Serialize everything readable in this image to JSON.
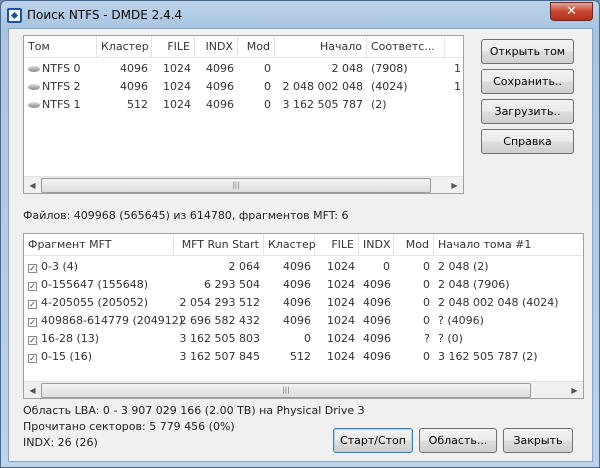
{
  "window": {
    "title": "Поиск NTFS - DMDE 2.4.4",
    "close": "✕"
  },
  "volumes": {
    "columns": [
      "Том",
      "Кластер",
      "FILE",
      "INDX",
      "Mod",
      "Начало",
      "Соответс..."
    ],
    "rows": [
      {
        "name": "NTFS 0",
        "cluster": "4096",
        "file": "1024",
        "indx": "4096",
        "mod": "0",
        "start": "2 048",
        "match": "(7908)",
        "extra": "1"
      },
      {
        "name": "NTFS 2",
        "cluster": "4096",
        "file": "1024",
        "indx": "4096",
        "mod": "0",
        "start": "2 048 002 048",
        "match": "(4024)",
        "extra": "1"
      },
      {
        "name": "NTFS 1",
        "cluster": "512",
        "file": "1024",
        "indx": "4096",
        "mod": "0",
        "start": "3 162 505 787",
        "match": "(2)",
        "extra": ""
      }
    ]
  },
  "buttons": {
    "open": "Открыть том",
    "save": "Сохранить..",
    "load": "Загрузить..",
    "help": "Справка",
    "startstop": "Старт/Стоп",
    "area": "Область...",
    "close": "Закрыть"
  },
  "files_summary": "Файлов: 409968 (565645) из 614780, фрагментов MFT: 6",
  "fragments": {
    "columns": [
      "Фрагмент MFT",
      "MFT Run Start",
      "Кластер",
      "FILE",
      "INDX",
      "Mod",
      "Начало тома #1"
    ],
    "rows": [
      {
        "frag": "0-3 (4)",
        "run": "2 064",
        "cluster": "4096",
        "file": "1024",
        "indx": "0",
        "mod": "0",
        "start": "2 048 (2)"
      },
      {
        "frag": "0-155647 (155648)",
        "run": "6 293 504",
        "cluster": "4096",
        "file": "1024",
        "indx": "4096",
        "mod": "0",
        "start": "2 048 (7906)"
      },
      {
        "frag": "4-205055 (205052)",
        "run": "2 054 293 512",
        "cluster": "4096",
        "file": "1024",
        "indx": "4096",
        "mod": "0",
        "start": "2 048 002 048 (4024)"
      },
      {
        "frag": "409868-614779 (204912)",
        "run": "2 696 582 432",
        "cluster": "4096",
        "file": "1024",
        "indx": "4096",
        "mod": "0",
        "start": "? (4096)"
      },
      {
        "frag": "16-28 (13)",
        "run": "3 162 505 803",
        "cluster": "0",
        "file": "1024",
        "indx": "4096",
        "mod": "?",
        "start": "? (0)"
      },
      {
        "frag": "0-15 (16)",
        "run": "3 162 507 845",
        "cluster": "512",
        "file": "1024",
        "indx": "4096",
        "mod": "0",
        "start": "3 162 505 787 (2)"
      }
    ]
  },
  "status": {
    "lba": "Область LBA: 0 - 3 907 029 166 (2.00 TB) на Physical Drive 3",
    "sectors": "Прочитано секторов: 5 779 456 (0%)",
    "indx": "INDX: 26 (26)"
  }
}
